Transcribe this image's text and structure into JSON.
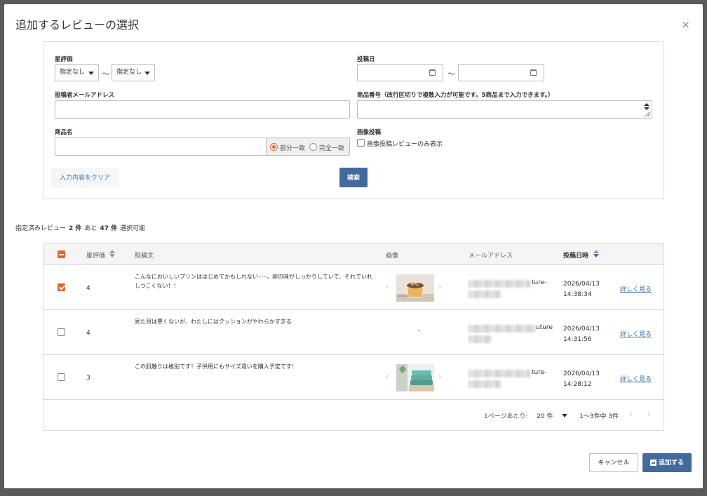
{
  "modal": {
    "title": "追加するレビューの選択",
    "close_glyph": "×"
  },
  "filters": {
    "star_label": "星評価",
    "star_from": "指定なし",
    "star_to": "指定なし",
    "tilde": "〜",
    "post_date_label": "投稿日",
    "email_label": "投稿者メールアドレス",
    "product_no_label": "商品番号（改行区切りで複数入力が可能です。5商品まで入力できます。）",
    "product_name_label": "商品名",
    "match_partial": "部分一致",
    "match_exact": "完全一致",
    "image_post_label": "画像投稿",
    "image_only_label": "画像投稿レビューのみ表示",
    "clear_button": "入力内容をクリア",
    "search_button": "検索"
  },
  "selection": {
    "prefix": "指定済みレビュー",
    "selected": "2 件",
    "middle": "あと",
    "remaining": "47 件",
    "suffix": "選択可能"
  },
  "table": {
    "headers": [
      "星評価",
      "投稿文",
      "画像",
      "メールアドレス",
      "投稿日時"
    ],
    "rows": [
      {
        "checked": true,
        "star": "4",
        "body": "こんなにおいしいプリンははじめてかもしれない･･･。卵の味がしっかりしていて、それでいれしつこくない！！",
        "email_visible": "ture-",
        "datetime": [
          "2026/04/13",
          "14:38:34"
        ],
        "detail": "詳しく見る"
      },
      {
        "checked": false,
        "star": "4",
        "body": "見た目は悪くないが、わたしにはクッションがやわらかすぎる",
        "image_placeholder": "-",
        "email_visible": "uture",
        "datetime": [
          "2026/04/13",
          "14:31:56"
        ],
        "detail": "詳しく見る"
      },
      {
        "checked": false,
        "star": "3",
        "body": "この肌触りは格別です！子供用にもサイズ違いを購入予定です！",
        "email_visible": "ture-",
        "datetime": [
          "2026/04/13",
          "14:28:12"
        ],
        "detail": "詳しく見る"
      }
    ],
    "pagination": {
      "per_page_label": "1ページあたり:",
      "per_page_value": "20 件",
      "range": "1〜3件中 3件",
      "prev": "‹",
      "next": "›"
    }
  },
  "footer": {
    "cancel": "キャンセル",
    "add": "追加する"
  }
}
